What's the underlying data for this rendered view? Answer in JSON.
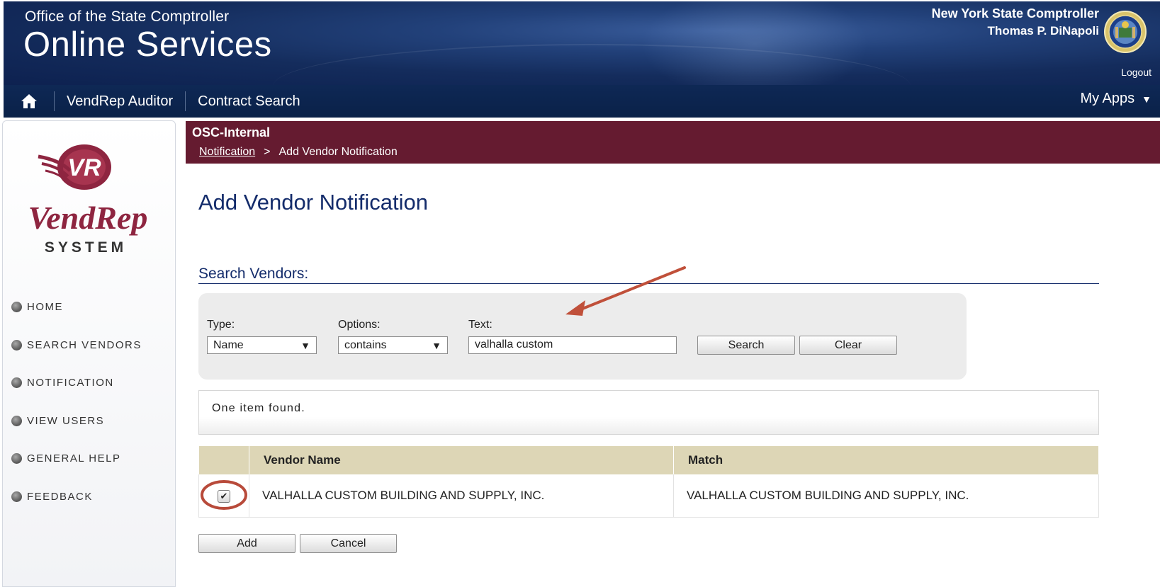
{
  "header": {
    "office": "Office of the State Comptroller",
    "title": "Online Services",
    "comptroller_title": "New York State Comptroller",
    "comptroller_name": "Thomas P. DiNapoli",
    "logout": "Logout"
  },
  "nav": {
    "home_icon": "home-icon",
    "items": [
      {
        "label": "VendRep Auditor"
      },
      {
        "label": "Contract Search"
      }
    ],
    "myapps": "My Apps",
    "myapps_arrow": "▼"
  },
  "sidebar": {
    "logo_text": "VendRep",
    "logo_sub": "SYSTEM",
    "logo_mark": "VR",
    "items": [
      {
        "label": "HOME"
      },
      {
        "label": "SEARCH VENDORS"
      },
      {
        "label": "NOTIFICATION"
      },
      {
        "label": "VIEW USERS"
      },
      {
        "label": "GENERAL HELP"
      },
      {
        "label": "FEEDBACK"
      }
    ]
  },
  "main": {
    "section_bar_title": "OSC-Internal",
    "breadcrumb": {
      "parent": "Notification",
      "separator": ">",
      "current": "Add Vendor Notification"
    },
    "page_title": "Add Vendor Notification",
    "search_title": "Search Vendors:",
    "search": {
      "type_label": "Type:",
      "type_value": "Name",
      "options_label": "Options:",
      "options_value": "contains",
      "text_label": "Text:",
      "text_value": "valhalla custom",
      "search_button": "Search",
      "clear_button": "Clear",
      "dropdown_arrow": "▼"
    },
    "result_message": "One item found.",
    "table": {
      "headers": [
        "",
        "Vendor Name",
        "Match"
      ],
      "rows": [
        {
          "checked": true,
          "check_mark": "✔",
          "vendor_name": "VALHALLA CUSTOM BUILDING AND SUPPLY, INC.",
          "match": "VALHALLA CUSTOM BUILDING AND SUPPLY, INC."
        }
      ]
    },
    "add_button": "Add",
    "cancel_button": "Cancel"
  },
  "colors": {
    "header_navy": "#142c5c",
    "nav_navy": "#0a2148",
    "crumb_maroon": "#651b30",
    "title_blue": "#142c6b",
    "table_header": "#ddd6b6",
    "annotation_red": "#c0503a"
  }
}
